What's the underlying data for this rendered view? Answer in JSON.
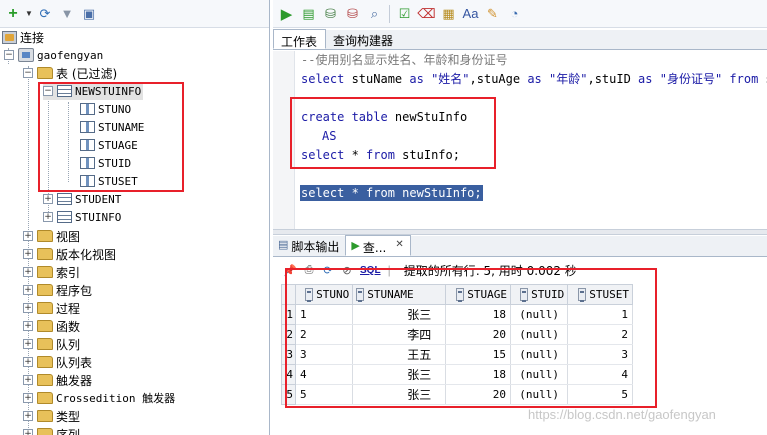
{
  "navigator": {
    "toolbar_icons": [
      "add-connection-icon",
      "refresh-icon",
      "filter-icon",
      "schema-browser-icon"
    ],
    "connections_label": "连接",
    "connection_name": "gaofengyan",
    "tables_label": "表 (已过滤)",
    "tables": [
      {
        "name": "NEWSTUINFO",
        "expanded": true,
        "columns": [
          "STUNO",
          "STUNAME",
          "STUAGE",
          "STUID",
          "STUSET"
        ]
      },
      {
        "name": "STUDENT",
        "expanded": false
      },
      {
        "name": "STUINFO",
        "expanded": false
      }
    ],
    "folders": [
      "视图",
      "版本化视图",
      "索引",
      "程序包",
      "过程",
      "函数",
      "队列",
      "队列表",
      "触发器",
      "Crossedition 触发器",
      "类型",
      "序列"
    ]
  },
  "editor": {
    "tabs": [
      "工作表",
      "查询构建器"
    ],
    "active_tab": "工作表",
    "lines": {
      "comment": "--使用别名显示姓名、年龄和身份证号",
      "select_alias_kw1": "select",
      "select_alias_rest1": " stuName ",
      "select_alias_kw2": "as",
      "select_alias_str1": " \"姓名\"",
      "select_alias_rest2": ",stuAge ",
      "select_alias_kw3": "as",
      "select_alias_str2": " \"年龄\"",
      "select_alias_rest3": ",stuID ",
      "select_alias_kw4": "as",
      "select_alias_str3": " \"身份证号\" ",
      "select_alias_kw5": "from",
      "select_alias_rest4": " st",
      "create_kw": "create table",
      "create_rest": " newStuInfo",
      "as_kw": "AS",
      "select_kw": "select",
      "select_star": " * ",
      "from_kw": "from",
      "from_rest": " stuInfo;",
      "highlight_line": "select * from newStuInfo;"
    }
  },
  "output": {
    "tabs": [
      "脚本输出",
      "查..."
    ],
    "active_tab": "查...",
    "sql_label": "SQL",
    "status": "提取的所有行: 5, 用时 0.002 秒",
    "columns": [
      "STUNO",
      "STUNAME",
      "STUAGE",
      "STUID",
      "STUSET"
    ],
    "rows": [
      {
        "rownum": "1",
        "stuno": "1",
        "stuname": "张三",
        "stuage": "18",
        "stuid": "(null)",
        "stuset": "1"
      },
      {
        "rownum": "2",
        "stuno": "2",
        "stuname": "李四",
        "stuage": "20",
        "stuid": "(null)",
        "stuset": "2"
      },
      {
        "rownum": "3",
        "stuno": "3",
        "stuname": "王五",
        "stuage": "15",
        "stuid": "(null)",
        "stuset": "3"
      },
      {
        "rownum": "4",
        "stuno": "4",
        "stuname": "张三",
        "stuage": "18",
        "stuid": "(null)",
        "stuset": "4"
      },
      {
        "rownum": "5",
        "stuno": "5",
        "stuname": "张三",
        "stuage": "20",
        "stuid": "(null)",
        "stuset": "5"
      }
    ]
  },
  "watermark": "https://blog.csdn.net/gaofengyan",
  "colors": {
    "annotation_red": "#e8202a",
    "selection_blue": "#3a5fa0",
    "keyword_blue": "#1a1aa6"
  }
}
